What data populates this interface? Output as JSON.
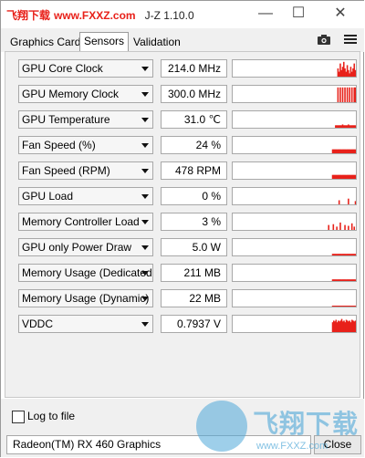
{
  "window": {
    "watermark": "飞翔下载",
    "watermark_url": "www.FXXZ.com",
    "title": "J-Z 1.10.0",
    "minimize_glyph": "—",
    "maximize_glyph": "☐",
    "close_glyph": "✕"
  },
  "tabs": [
    {
      "label": "Graphics Card",
      "active": false
    },
    {
      "label": "Sensors",
      "active": true
    },
    {
      "label": "Validation",
      "active": false
    }
  ],
  "toolbar": {
    "camera_icon": "camera-icon",
    "menu_icon": "hamburger-menu-icon"
  },
  "sensors": [
    {
      "name": "GPU Core Clock",
      "value": "214.0 MHz",
      "graph": [
        0,
        0,
        0,
        0,
        0,
        0,
        0,
        0,
        0,
        0,
        0,
        0,
        0,
        0,
        0,
        0,
        0,
        0,
        0,
        0,
        0,
        0,
        0,
        0,
        0,
        0,
        0,
        0,
        0,
        0,
        0,
        0,
        0,
        0,
        0,
        0,
        0,
        0,
        0,
        0,
        0,
        0,
        0,
        0,
        0,
        0,
        0,
        0,
        0,
        0,
        0,
        0,
        0,
        0,
        0,
        0,
        0,
        0,
        0,
        0,
        0,
        0,
        0,
        0,
        0,
        0,
        0,
        0,
        0,
        0,
        0,
        0,
        0,
        0,
        0,
        0,
        0,
        0,
        0,
        0,
        0,
        0,
        0,
        0,
        0,
        0,
        0,
        0,
        0,
        0,
        0.5,
        0.3,
        0.8,
        0.4,
        0.6,
        0.9,
        0.5,
        0.3,
        0.7,
        0.4,
        0.2,
        0.6,
        0.3,
        0.5,
        0.8,
        0.4
      ]
    },
    {
      "name": "GPU Memory Clock",
      "value": "300.0 MHz",
      "graph": [
        0,
        0,
        0,
        0,
        0,
        0,
        0,
        0,
        0,
        0,
        0,
        0,
        0,
        0,
        0,
        0,
        0,
        0,
        0,
        0,
        0,
        0,
        0,
        0,
        0,
        0,
        0,
        0,
        0,
        0,
        0,
        0,
        0,
        0,
        0,
        0,
        0,
        0,
        0,
        0,
        0,
        0,
        0,
        0,
        0,
        0,
        0,
        0,
        0,
        0,
        0,
        0,
        0,
        0,
        0,
        0,
        0,
        0,
        0,
        0,
        0,
        0,
        0,
        0,
        0,
        0,
        0,
        0,
        0,
        0,
        0,
        0,
        0,
        0,
        0,
        0,
        0,
        0,
        0,
        0,
        0,
        0,
        0,
        0,
        0,
        0,
        0,
        0,
        0,
        0,
        0.9,
        0,
        0.9,
        0,
        0.9,
        0,
        0.9,
        0,
        0.9,
        0,
        0.9,
        0,
        0.9,
        0,
        0.9,
        0.9
      ]
    },
    {
      "name": "GPU Temperature",
      "value": "31.0 ℃",
      "graph": [
        0,
        0,
        0,
        0,
        0,
        0,
        0,
        0,
        0,
        0,
        0,
        0,
        0,
        0,
        0,
        0,
        0,
        0,
        0,
        0,
        0,
        0,
        0,
        0,
        0,
        0,
        0,
        0,
        0,
        0,
        0,
        0,
        0,
        0,
        0,
        0,
        0,
        0,
        0,
        0,
        0,
        0,
        0,
        0,
        0,
        0,
        0,
        0,
        0,
        0,
        0,
        0,
        0,
        0,
        0,
        0,
        0,
        0,
        0,
        0,
        0,
        0,
        0,
        0,
        0,
        0,
        0,
        0,
        0,
        0,
        0,
        0,
        0,
        0,
        0,
        0,
        0,
        0,
        0,
        0,
        0,
        0,
        0,
        0,
        0,
        0,
        0,
        0,
        0.15,
        0.15,
        0.15,
        0.15,
        0.15,
        0.15,
        0.2,
        0.15,
        0.15,
        0.15,
        0.15,
        0.2,
        0.15,
        0.15,
        0.15,
        0.15,
        0.15,
        0.15
      ]
    },
    {
      "name": "Fan Speed (%)",
      "value": "24 %",
      "graph": [
        0,
        0,
        0,
        0,
        0,
        0,
        0,
        0,
        0,
        0,
        0,
        0,
        0,
        0,
        0,
        0,
        0,
        0,
        0,
        0,
        0,
        0,
        0,
        0,
        0,
        0,
        0,
        0,
        0,
        0,
        0,
        0,
        0,
        0,
        0,
        0,
        0,
        0,
        0,
        0,
        0,
        0,
        0,
        0,
        0,
        0,
        0,
        0,
        0,
        0,
        0,
        0,
        0,
        0,
        0,
        0,
        0,
        0,
        0,
        0,
        0,
        0,
        0,
        0,
        0,
        0,
        0,
        0,
        0,
        0,
        0,
        0,
        0,
        0,
        0,
        0,
        0,
        0,
        0,
        0,
        0,
        0,
        0,
        0,
        0,
        0,
        0,
        0.24,
        0.24,
        0.24,
        0.24,
        0.24,
        0.24,
        0.24,
        0.24,
        0.24,
        0.24,
        0.24,
        0.24,
        0.24,
        0.24,
        0.24,
        0.24,
        0.24,
        0.24,
        0.24,
        0.24,
        0.24
      ]
    },
    {
      "name": "Fan Speed (RPM)",
      "value": "478 RPM",
      "graph": [
        0,
        0,
        0,
        0,
        0,
        0,
        0,
        0,
        0,
        0,
        0,
        0,
        0,
        0,
        0,
        0,
        0,
        0,
        0,
        0,
        0,
        0,
        0,
        0,
        0,
        0,
        0,
        0,
        0,
        0,
        0,
        0,
        0,
        0,
        0,
        0,
        0,
        0,
        0,
        0,
        0,
        0,
        0,
        0,
        0,
        0,
        0,
        0,
        0,
        0,
        0,
        0,
        0,
        0,
        0,
        0,
        0,
        0,
        0,
        0,
        0,
        0,
        0,
        0,
        0,
        0,
        0,
        0,
        0,
        0,
        0,
        0,
        0,
        0,
        0,
        0,
        0,
        0,
        0,
        0,
        0,
        0,
        0,
        0,
        0,
        0,
        0,
        0.24,
        0.24,
        0.24,
        0.24,
        0.24,
        0.24,
        0.24,
        0.24,
        0.24,
        0.24,
        0.24,
        0.24,
        0.24,
        0.24,
        0.24,
        0.24,
        0.24,
        0.24,
        0.24,
        0.24,
        0.24
      ]
    },
    {
      "name": "GPU Load",
      "value": "0 %",
      "graph": [
        0,
        0,
        0,
        0,
        0,
        0,
        0,
        0,
        0,
        0,
        0,
        0,
        0,
        0,
        0,
        0,
        0,
        0,
        0,
        0,
        0,
        0,
        0,
        0,
        0,
        0,
        0,
        0,
        0,
        0,
        0,
        0,
        0,
        0,
        0,
        0,
        0,
        0,
        0,
        0,
        0,
        0,
        0,
        0,
        0,
        0,
        0,
        0,
        0,
        0,
        0,
        0,
        0,
        0,
        0,
        0,
        0,
        0,
        0,
        0,
        0,
        0,
        0,
        0,
        0,
        0,
        0,
        0,
        0,
        0,
        0,
        0,
        0,
        0,
        0,
        0,
        0,
        0,
        0,
        0,
        0,
        0,
        0,
        0,
        0,
        0,
        0,
        0,
        0,
        0,
        0,
        0.25,
        0,
        0,
        0,
        0,
        0,
        0,
        0,
        0.35,
        0,
        0,
        0,
        0,
        0,
        0.2
      ]
    },
    {
      "name": "Memory Controller Load",
      "value": "3 %",
      "graph": [
        0,
        0,
        0,
        0,
        0,
        0,
        0,
        0,
        0,
        0,
        0,
        0,
        0,
        0,
        0,
        0,
        0,
        0,
        0,
        0,
        0,
        0,
        0,
        0,
        0,
        0,
        0,
        0,
        0,
        0,
        0,
        0,
        0,
        0,
        0,
        0,
        0,
        0,
        0,
        0,
        0,
        0,
        0,
        0,
        0,
        0,
        0,
        0,
        0,
        0,
        0,
        0,
        0,
        0,
        0,
        0,
        0,
        0,
        0,
        0,
        0,
        0,
        0,
        0,
        0,
        0,
        0,
        0,
        0,
        0,
        0,
        0,
        0,
        0,
        0,
        0,
        0,
        0,
        0,
        0,
        0,
        0,
        0.3,
        0,
        0,
        0,
        0.35,
        0,
        0,
        0.2,
        0,
        0,
        0.45,
        0,
        0,
        0,
        0.3,
        0,
        0,
        0.25,
        0,
        0,
        0.4,
        0,
        0.2,
        0
      ]
    },
    {
      "name": "GPU only Power Draw",
      "value": "5.0 W",
      "graph": [
        0,
        0,
        0,
        0,
        0,
        0,
        0,
        0,
        0,
        0,
        0,
        0,
        0,
        0,
        0,
        0,
        0,
        0,
        0,
        0,
        0,
        0,
        0,
        0,
        0,
        0,
        0,
        0,
        0,
        0,
        0,
        0,
        0,
        0,
        0,
        0,
        0,
        0,
        0,
        0,
        0,
        0,
        0,
        0,
        0,
        0,
        0,
        0,
        0,
        0,
        0,
        0,
        0,
        0,
        0,
        0,
        0,
        0,
        0,
        0,
        0,
        0,
        0,
        0,
        0,
        0,
        0,
        0,
        0,
        0,
        0,
        0,
        0,
        0,
        0,
        0,
        0,
        0,
        0,
        0,
        0,
        0,
        0,
        0,
        0,
        0,
        0,
        0.1,
        0.1,
        0.1,
        0.1,
        0.1,
        0.1,
        0.1,
        0.1,
        0.1,
        0.1,
        0.1,
        0.1,
        0.1,
        0.1,
        0.1,
        0.1,
        0.1,
        0.1,
        0.1,
        0.1,
        0.1
      ]
    },
    {
      "name": "Memory Usage (Dedicated)",
      "value": "211 MB",
      "graph": [
        0,
        0,
        0,
        0,
        0,
        0,
        0,
        0,
        0,
        0,
        0,
        0,
        0,
        0,
        0,
        0,
        0,
        0,
        0,
        0,
        0,
        0,
        0,
        0,
        0,
        0,
        0,
        0,
        0,
        0,
        0,
        0,
        0,
        0,
        0,
        0,
        0,
        0,
        0,
        0,
        0,
        0,
        0,
        0,
        0,
        0,
        0,
        0,
        0,
        0,
        0,
        0,
        0,
        0,
        0,
        0,
        0,
        0,
        0,
        0,
        0,
        0,
        0,
        0,
        0,
        0,
        0,
        0,
        0,
        0,
        0,
        0,
        0,
        0,
        0,
        0,
        0,
        0,
        0,
        0,
        0,
        0,
        0,
        0,
        0,
        0,
        0,
        0.1,
        0.1,
        0.1,
        0.1,
        0.1,
        0.1,
        0.1,
        0.1,
        0.1,
        0.1,
        0.1,
        0.1,
        0.1,
        0.1,
        0.1,
        0.1,
        0.1,
        0.1,
        0.1,
        0.1,
        0.1
      ]
    },
    {
      "name": "Memory Usage (Dynamic)",
      "value": "22 MB",
      "graph": [
        0,
        0,
        0,
        0,
        0,
        0,
        0,
        0,
        0,
        0,
        0,
        0,
        0,
        0,
        0,
        0,
        0,
        0,
        0,
        0,
        0,
        0,
        0,
        0,
        0,
        0,
        0,
        0,
        0,
        0,
        0,
        0,
        0,
        0,
        0,
        0,
        0,
        0,
        0,
        0,
        0,
        0,
        0,
        0,
        0,
        0,
        0,
        0,
        0,
        0,
        0,
        0,
        0,
        0,
        0,
        0,
        0,
        0,
        0,
        0,
        0,
        0,
        0,
        0,
        0,
        0,
        0,
        0,
        0,
        0,
        0,
        0,
        0,
        0,
        0,
        0,
        0,
        0,
        0,
        0,
        0,
        0,
        0,
        0,
        0,
        0,
        0,
        0.05,
        0.05,
        0.05,
        0.05,
        0.05,
        0.05,
        0.05,
        0.05,
        0.05,
        0.05,
        0.05,
        0.05,
        0.05,
        0.05,
        0.05,
        0.05,
        0.05,
        0.05,
        0.05,
        0.05,
        0.05
      ]
    },
    {
      "name": "VDDC",
      "value": "0.7937 V",
      "graph": [
        0,
        0,
        0,
        0,
        0,
        0,
        0,
        0,
        0,
        0,
        0,
        0,
        0,
        0,
        0,
        0,
        0,
        0,
        0,
        0,
        0,
        0,
        0,
        0,
        0,
        0,
        0,
        0,
        0,
        0,
        0,
        0,
        0,
        0,
        0,
        0,
        0,
        0,
        0,
        0,
        0,
        0,
        0,
        0,
        0,
        0,
        0,
        0,
        0,
        0,
        0,
        0,
        0,
        0,
        0,
        0,
        0,
        0,
        0,
        0,
        0,
        0,
        0,
        0,
        0,
        0,
        0,
        0,
        0,
        0,
        0,
        0,
        0,
        0,
        0,
        0,
        0,
        0,
        0,
        0,
        0,
        0,
        0,
        0,
        0,
        0,
        0,
        0.6,
        0.7,
        0.65,
        0.75,
        0.6,
        0.7,
        0.65,
        0.7,
        0.8,
        0.65,
        0.7,
        0.6,
        0.75,
        0.7,
        0.65,
        0.7,
        0.6,
        0.75,
        0.7,
        0.65,
        0.7
      ]
    }
  ],
  "graph_color": "#e8211a",
  "footer": {
    "log_label": "Log to file",
    "log_checked": false,
    "gpu_selected": "Radeon(TM) RX 460 Graphics",
    "close_label": "Close",
    "logo_text": "飞翔下载",
    "logo_url": "www.FXXZ.com"
  }
}
